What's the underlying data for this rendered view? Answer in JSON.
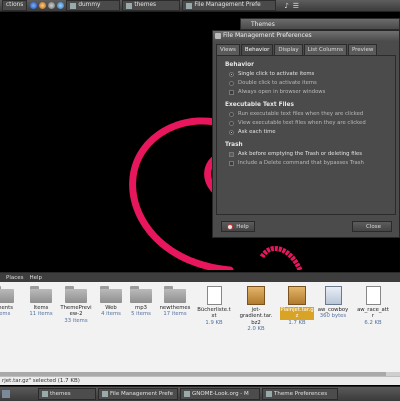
{
  "top_panel": {
    "menu_label": "ctions",
    "dummy_label": "dummy",
    "themes_label": "themes",
    "window_label": "File Management Prefe"
  },
  "themes_window": {
    "title": "Themes"
  },
  "prefs": {
    "title": "File Management Preferences",
    "tabs": [
      "Views",
      "Behavior",
      "Display",
      "List Columns",
      "Preview"
    ],
    "active_tab": "Behavior",
    "behavior": {
      "heading": "Behavior",
      "options": [
        "Single click to activate items",
        "Double click to activate items",
        "Always open in browser windows"
      ]
    },
    "exec": {
      "heading": "Executable Text Files",
      "options": [
        "Run executable text files when they are clicked",
        "View executable text files when they are clicked",
        "Ask each time"
      ]
    },
    "trash": {
      "heading": "Trash",
      "options": [
        "Ask before emptying the Trash or deleting files",
        "Include a Delete command that bypasses Trash"
      ]
    },
    "help_label": "Help",
    "close_label": "Close"
  },
  "menubar": {
    "places": "Places",
    "help": "Help"
  },
  "files": [
    {
      "name": "uments",
      "sub": "items",
      "icon": "folder"
    },
    {
      "name": "Items",
      "sub": "11 items",
      "icon": "folder"
    },
    {
      "name": "ThemePrevi ew-2",
      "sub": "33 items",
      "icon": "folder"
    },
    {
      "name": "Web",
      "sub": "4 items",
      "icon": "folder"
    },
    {
      "name": "mp3",
      "sub": "5 items",
      "icon": "folder"
    },
    {
      "name": "newthemes",
      "sub": "17 items",
      "icon": "folder"
    },
    {
      "name": "Bücherliste.t xt",
      "sub": "1.9 KB",
      "icon": "document"
    },
    {
      "name": "jet-gradient.tar. bz2",
      "sub": "2.0 KB",
      "icon": "package"
    },
    {
      "name": "Plainjet.tar.g z",
      "sub": "1.7 KB",
      "icon": "package"
    },
    {
      "name": "aw_cowboy",
      "sub": "360 bytes",
      "icon": "image"
    },
    {
      "name": "aw_race_att r",
      "sub": "6.2 KB",
      "icon": "document"
    }
  ],
  "status": "rjet.tar.gz\" selected (1.7 KB)",
  "taskbar": [
    "themes",
    "File Management Prefe",
    "GNOME-Look.org - M",
    "Theme Preferences"
  ],
  "colors": {
    "accent": "#d8a326",
    "swirl": "#e8175d"
  }
}
